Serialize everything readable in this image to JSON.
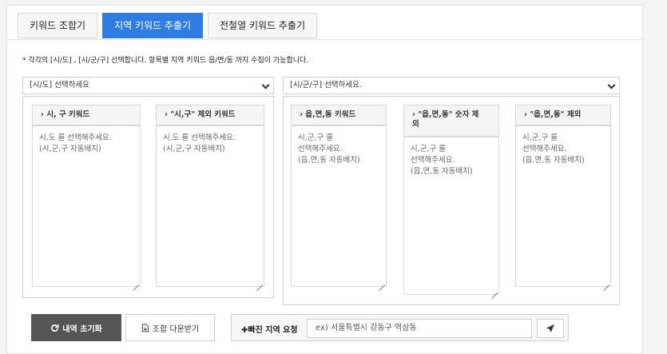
{
  "tabs": [
    {
      "label": "키워드 조합기",
      "active": false
    },
    {
      "label": "지역 키워드 추출기",
      "active": true
    },
    {
      "label": "전철열 키워드 추출기",
      "active": false
    }
  ],
  "notice": "* 각각의 [시/도] , [시/군/구] 선택합니다. 항목별 지역 키워드 읍/면/동 까지 수집이 가능합니다.",
  "left": {
    "select": "[시/도] 선택하세요",
    "columns": [
      {
        "header": "› 시, 구 키워드",
        "placeholder": "시,도 를 선택해주세요.\n(시,군,구 자동배치)"
      },
      {
        "header": "› \"시,구\" 제외 키워드",
        "placeholder": "시,도 를 선택해주세요.\n(시,군,구 자동배치)"
      }
    ]
  },
  "right": {
    "select": "[시/군/구] 선택하세요.",
    "columns": [
      {
        "header": "› 읍,면,동 키워드",
        "placeholder": "시,군,구 를\n선택해주세요.\n(읍,면,동 자동배치)"
      },
      {
        "header": "› \"읍,면,동\" 숫자 제\n외",
        "placeholder": "시,군,구 를\n선택해주세요.\n(읍,면,동 자동배치)"
      },
      {
        "header": "› \"읍,면,동\" 제외",
        "placeholder": "시,군,구 를\n선택해주세요.\n(읍,면,동 자동배치)"
      }
    ]
  },
  "actions": {
    "reset_label": "내역 초기화",
    "download_label": "조합 다운받기"
  },
  "request": {
    "label": "✚빠진 지역 요청",
    "placeholder": "ex) 서울특별시 강동구 역삼동"
  },
  "colors": {
    "accent": "#2f7de1",
    "dark_button": "#555555"
  }
}
